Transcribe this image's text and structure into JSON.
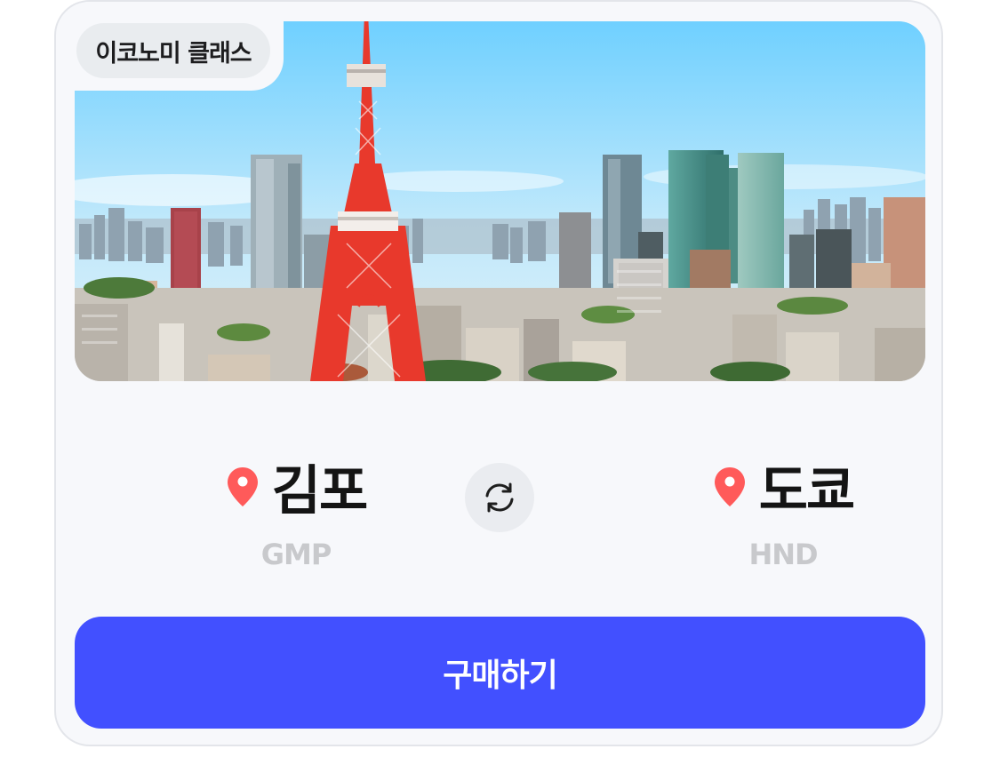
{
  "badge": {
    "label": "이코노미 클래스"
  },
  "hero": {
    "image": "tokyo-skyline-with-tokyo-tower"
  },
  "route": {
    "origin": {
      "city": "김포",
      "code": "GMP",
      "icon": "location-pin-icon"
    },
    "destination": {
      "city": "도쿄",
      "code": "HND",
      "icon": "location-pin-icon"
    },
    "swap_icon": "swap-arrows-icon"
  },
  "actions": {
    "buy_label": "구매하기"
  },
  "colors": {
    "accent": "#4250ff",
    "pin": "#ff5a5a",
    "code_text": "#c8c9cc",
    "card_bg": "#f7f8fb"
  }
}
